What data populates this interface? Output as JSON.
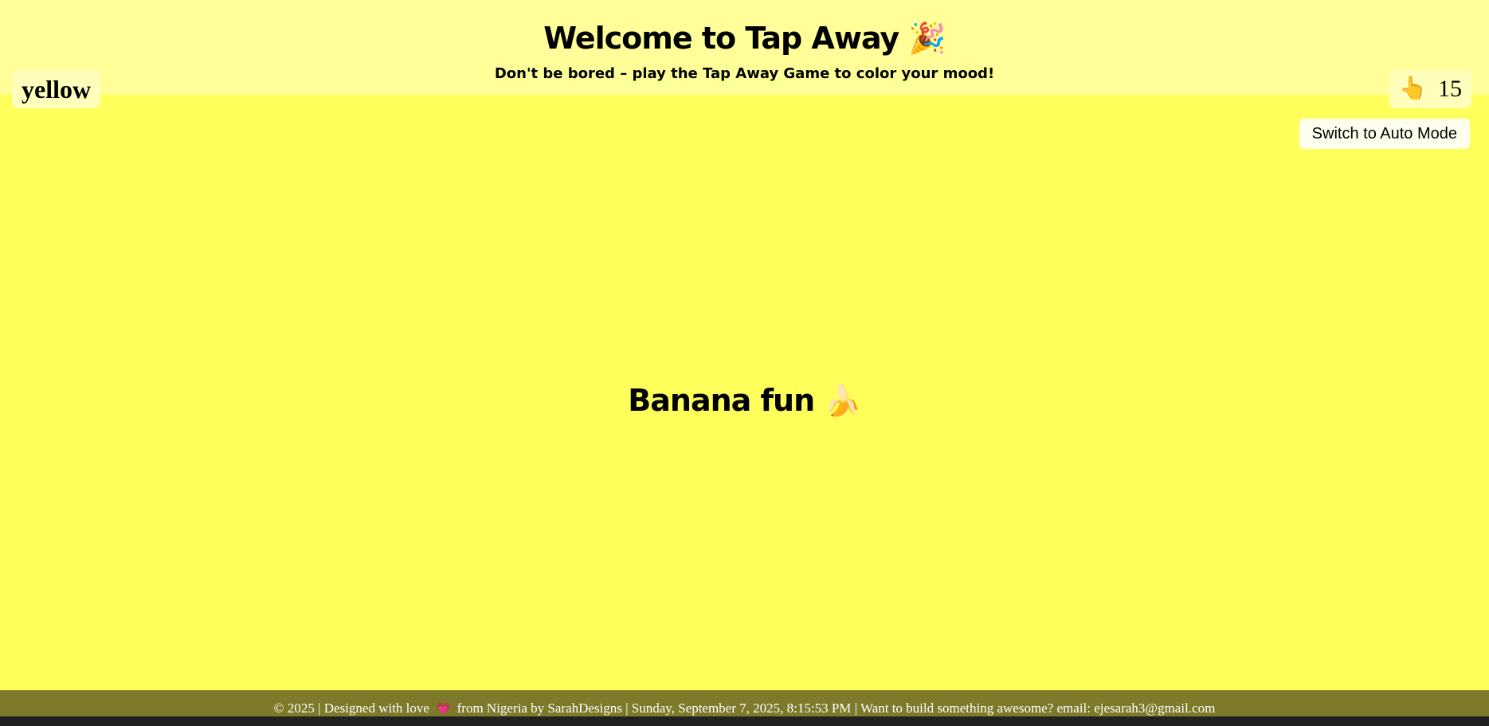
{
  "header": {
    "title": "Welcome to Tap Away 🎉",
    "subtitle": "Don't be bored – play the Tap Away Game to color your mood!"
  },
  "status": {
    "current_color": "yellow",
    "tap_icon": "pointing-hand-icon",
    "tap_count": "15"
  },
  "controls": {
    "mode_button_label": "Switch to Auto Mode"
  },
  "mood": {
    "text": "Banana fun 🍌"
  },
  "footer": {
    "prefix": "© 2025 | Designed with love",
    "heart_icon": "heart-icon",
    "suffix": "from Nigeria by SarahDesigns | Sunday, September 7, 2025, 8:15:53 PM | Want to build something awesome? email: ejesarah3@gmail.com"
  },
  "colors": {
    "background": "#ffff5c",
    "header_background": "#ffff99",
    "footer_background": "#7d7a2a"
  }
}
